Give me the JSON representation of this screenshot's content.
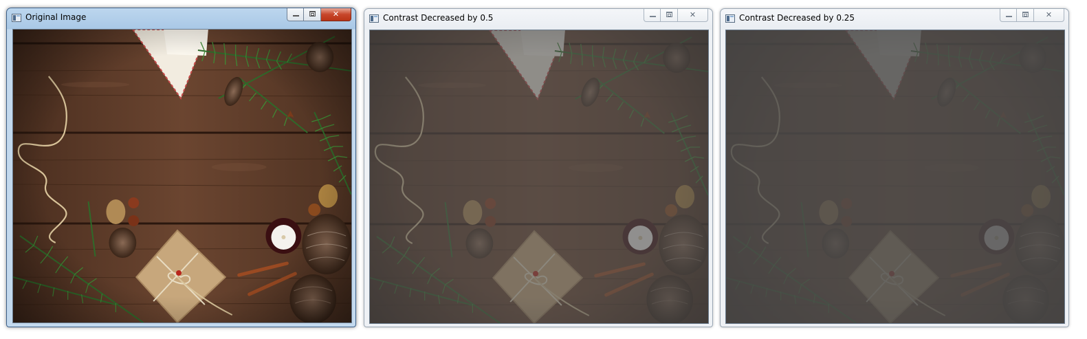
{
  "windows": [
    {
      "title": "Original Image",
      "state": "active",
      "contrast_factor": 1.0,
      "icon": "window-app-icon",
      "buttons": {
        "minimize": "minimize-icon",
        "maximize": "maximize-icon",
        "close": "close-icon"
      }
    },
    {
      "title": "Contrast Decreased by 0.5",
      "state": "inactive",
      "contrast_factor": 0.5,
      "icon": "window-app-icon",
      "buttons": {
        "minimize": "minimize-icon",
        "maximize": "maximize-icon",
        "close": "close-icon"
      }
    },
    {
      "title": "Contrast Decreased by 0.25",
      "state": "inactive",
      "contrast_factor": 0.25,
      "icon": "window-app-icon",
      "buttons": {
        "minimize": "minimize-icon",
        "maximize": "maximize-icon",
        "close": "close-icon"
      }
    }
  ],
  "colors": {
    "wood": "#5a3a28",
    "wood_dark": "#3b2418",
    "pine": "#2f5a2a",
    "active_close": "#c7462a"
  }
}
